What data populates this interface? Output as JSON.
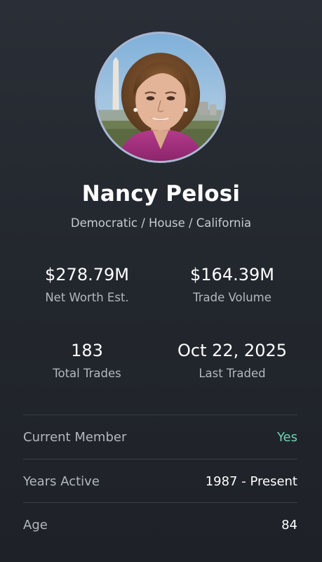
{
  "profile": {
    "name": "Nancy Pelosi",
    "subtitle": "Democratic / House / California",
    "accent_color": "#6fd3b4",
    "avatar_icon": "portrait-photo"
  },
  "stats": [
    {
      "value": "$278.79M",
      "label": "Net Worth Est."
    },
    {
      "value": "$164.39M",
      "label": "Trade Volume"
    },
    {
      "value": "183",
      "label": "Total Trades"
    },
    {
      "value": "Oct 22, 2025",
      "label": "Last Traded"
    }
  ],
  "details": [
    {
      "label": "Current Member",
      "value": "Yes"
    },
    {
      "label": "Years Active",
      "value": "1987 - Present"
    },
    {
      "label": "Age",
      "value": "84"
    }
  ]
}
